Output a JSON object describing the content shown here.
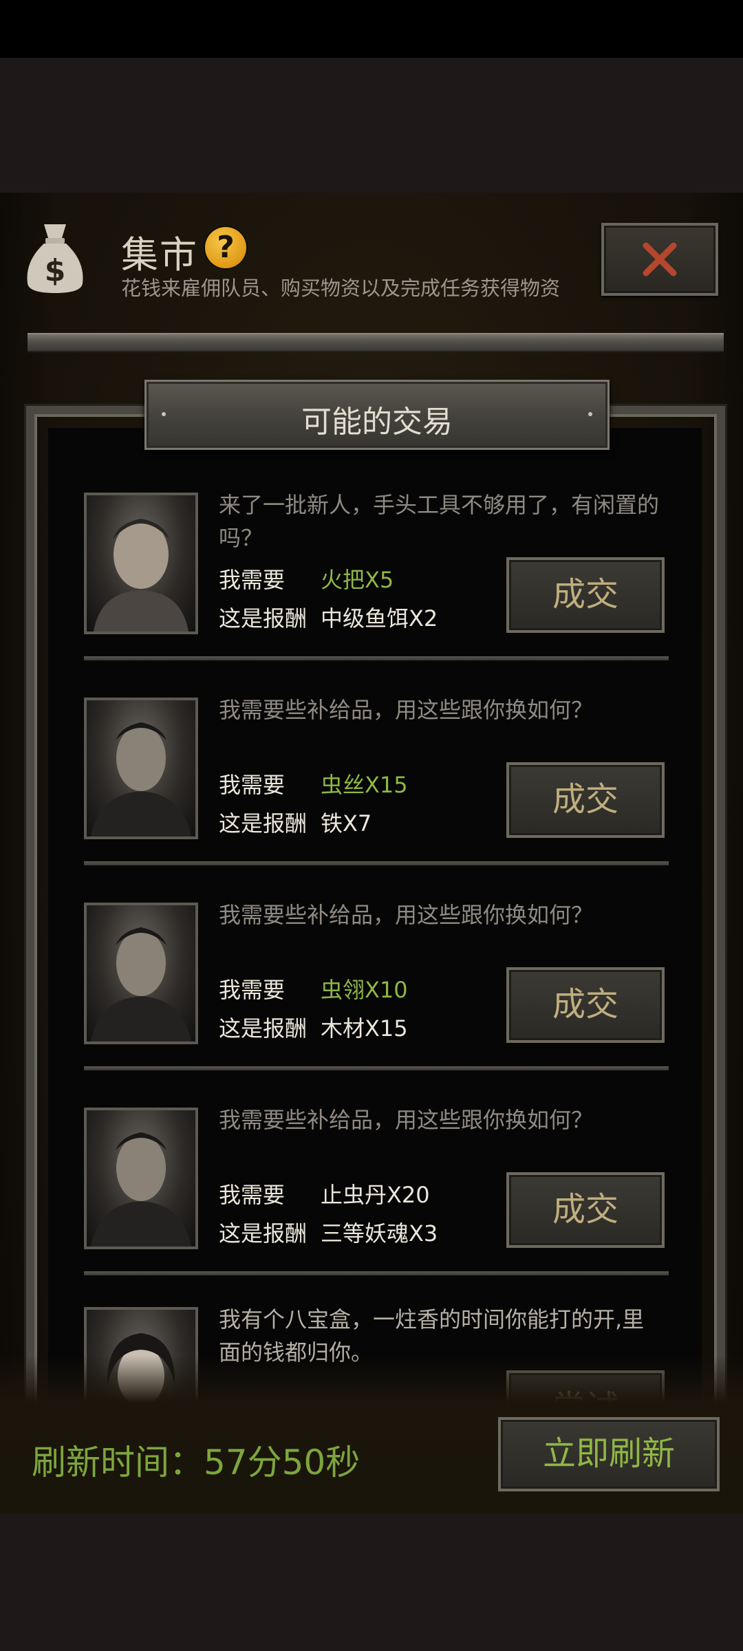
{
  "header": {
    "title": "集市",
    "help_icon_text": "?",
    "subtitle": "花钱来雇佣队员、购买物资以及完成任务获得物资",
    "close_icon": "close-x-icon",
    "money_icon": "money-bag-icon"
  },
  "section": {
    "title": "可能的交易"
  },
  "trades": [
    {
      "dialog": "来了一批新人，手头工具不够用了，有闲置的吗？",
      "need_label": "我需要",
      "need": "火把X5",
      "reward_label": "这是报酬",
      "reward": "中级鱼饵X2",
      "button": "成交"
    },
    {
      "dialog": "我需要些补给品，用这些跟你换如何？",
      "need_label": "我需要",
      "need": "虫丝X15",
      "reward_label": "这是报酬",
      "reward": "铁X7",
      "button": "成交"
    },
    {
      "dialog": "我需要些补给品，用这些跟你换如何？",
      "need_label": "我需要",
      "need": "虫翎X10",
      "reward_label": "这是报酬",
      "reward": "木材X15",
      "button": "成交"
    },
    {
      "dialog": "我需要些补给品，用这些跟你换如何？",
      "need_label": "我需要",
      "need": "止虫丹X20",
      "reward_label": "这是报酬",
      "reward": "三等妖魂X3",
      "button": "成交"
    },
    {
      "dialog": "我有个八宝盒，一炷香的时间你能打的开,里面的钱都归你。",
      "button": "尝试"
    }
  ],
  "footer": {
    "refresh_time": "刷新时间：57分50秒",
    "refresh_button": "立即刷新"
  },
  "colors": {
    "accent_green": "#8fb845",
    "gold_text": "#bfae7e",
    "panel_bg": "#1c160c"
  }
}
